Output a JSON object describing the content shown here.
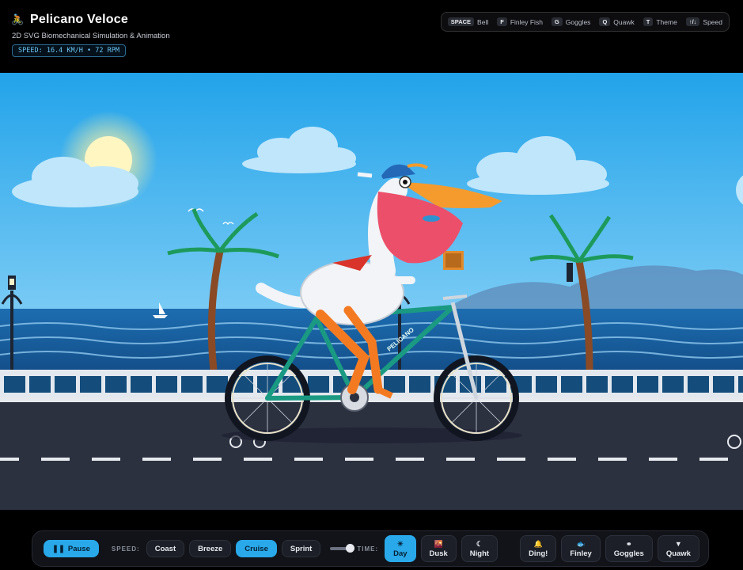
{
  "header": {
    "logo_icon": "cyclist-icon",
    "title": "Pelicano Veloce",
    "subtitle": "2D SVG Biomechanical Simulation & Animation",
    "speed_readout": "SPEED: 16.4 KM/H • 72 RPM"
  },
  "shortcuts": [
    {
      "key": "SPACE",
      "label": "Bell"
    },
    {
      "key": "F",
      "label": "Finley Fish"
    },
    {
      "key": "G",
      "label": "Goggles"
    },
    {
      "key": "Q",
      "label": "Quawk"
    },
    {
      "key": "T",
      "label": "Theme"
    },
    {
      "key": "↑/↓",
      "label": "Speed"
    }
  ],
  "scene": {
    "bike_text": "PELICANO",
    "sky_color": "#2aa9ea",
    "sea_color": "#1a66a8",
    "road_color": "#2c3140"
  },
  "controls": {
    "pause_label": "Pause",
    "speed_label": "SPEED:",
    "speed_options": [
      {
        "label": "Coast",
        "active": false
      },
      {
        "label": "Breeze",
        "active": false
      },
      {
        "label": "Cruise",
        "active": true
      },
      {
        "label": "Sprint",
        "active": false
      }
    ],
    "speed_slider_value": 0.35,
    "time_label": "TIME:",
    "time_options": [
      {
        "label": "Day",
        "icon": "sun-icon",
        "active": true
      },
      {
        "label": "Dusk",
        "icon": "sunset-icon",
        "active": false
      },
      {
        "label": "Night",
        "icon": "moon-icon",
        "active": false
      }
    ],
    "actions": [
      {
        "label": "Ding!",
        "icon": "bell-icon"
      },
      {
        "label": "Finley",
        "icon": "fish-icon"
      },
      {
        "label": "Goggles",
        "icon": "goggles-icon"
      },
      {
        "label": "Quawk",
        "icon": "beak-icon"
      }
    ]
  },
  "colors": {
    "accent": "#29a8ea",
    "readout": "#6cc4f3"
  }
}
